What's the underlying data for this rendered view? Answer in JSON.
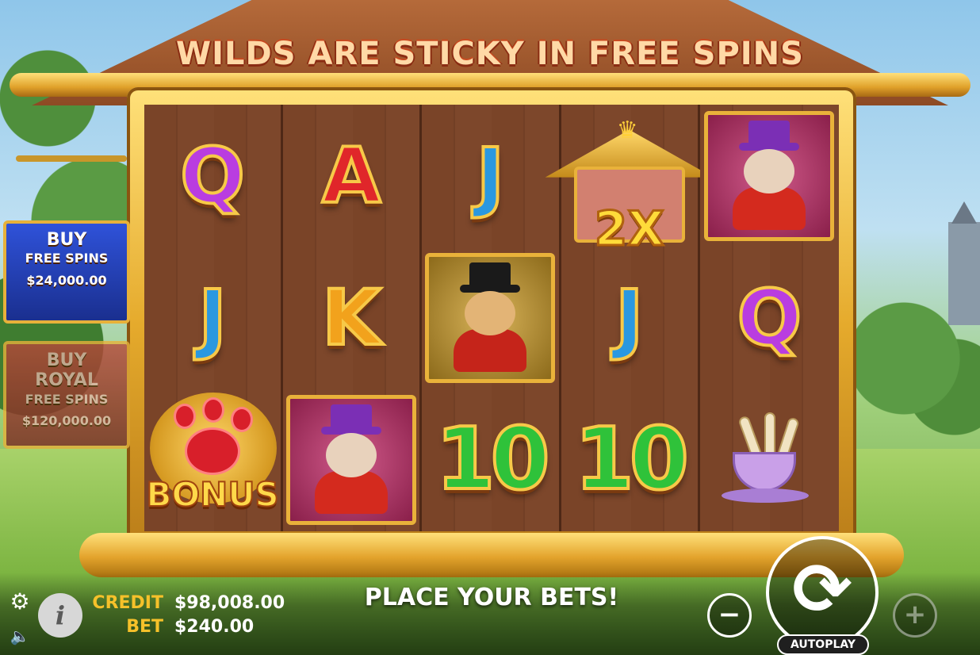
{
  "banner": {
    "text": "WILDS ARE STICKY IN FREE SPINS"
  },
  "side_panels": {
    "buy_free_spins": {
      "line1": "BUY",
      "line2": "FREE SPINS",
      "price": "$24,000.00"
    },
    "buy_royal_free_spins": {
      "line1": "BUY",
      "line2": "ROYAL",
      "line3": "FREE SPINS",
      "price": "$120,000.00"
    }
  },
  "reels": {
    "r1c1": {
      "type": "letter",
      "text": "Q",
      "color": "#b93de0"
    },
    "r1c2": {
      "type": "letter",
      "text": "A",
      "color": "#e0262a"
    },
    "r1c3": {
      "type": "letter",
      "text": "J",
      "color": "#2a98e0"
    },
    "r1c4": {
      "type": "doghouse-wild",
      "multiplier": "2X"
    },
    "r1c5": {
      "type": "card-yorkie",
      "icon": "yorkie-dog-icon"
    },
    "r2c1": {
      "type": "letter",
      "text": "J",
      "color": "#2a98e0"
    },
    "r2c2": {
      "type": "letter",
      "text": "K",
      "color": "#f2a21c"
    },
    "r2c3": {
      "type": "card-pug",
      "icon": "pug-dog-icon"
    },
    "r2c4": {
      "type": "letter",
      "text": "J",
      "color": "#2a98e0"
    },
    "r2c5": {
      "type": "letter",
      "text": "Q",
      "color": "#b93de0"
    },
    "r3c1": {
      "type": "bonus",
      "text": "BONUS"
    },
    "r3c2": {
      "type": "card-yorkie",
      "icon": "yorkie-dog-icon"
    },
    "r3c3": {
      "type": "letter",
      "text": "10",
      "color": "#2fc23a"
    },
    "r3c4": {
      "type": "letter",
      "text": "10",
      "color": "#2fc23a"
    },
    "r3c5": {
      "type": "teacup",
      "icon": "teacup-bones-icon"
    }
  },
  "hud": {
    "credit_label": "CREDIT",
    "credit_value": "$98,008.00",
    "bet_label": "BET",
    "bet_value": "$240.00",
    "message": "PLACE YOUR BETS!",
    "autoplay_label": "AUTOPLAY",
    "minus_symbol": "−",
    "plus_symbol": "+",
    "spin_symbol": "⟳",
    "info_symbol": "i",
    "gear_symbol": "⚙",
    "sound_symbol": "🔈"
  },
  "colors": {
    "gold": "#e9b23a",
    "credit_label": "#f6c12a",
    "buy_free_panel": "#2f52d9",
    "buy_royal_panel": "#b7483a"
  }
}
